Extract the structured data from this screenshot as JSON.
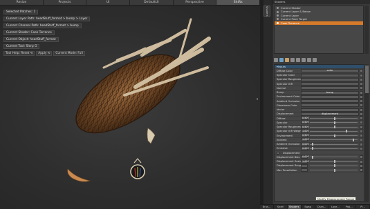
{
  "tabs": [
    "Resize",
    "Projects",
    "UI",
    "DefaultUI",
    "Perspective",
    "Shifts"
  ],
  "active_tab_index": 5,
  "viewport": {
    "info": [
      "Selected Patches: 1",
      "Current Layer Path: headStuff_format > bump > Layer",
      "Current Channel Path: headStuff_format > bump",
      "Current Shader: Cook Torrance",
      "Current Object: headStuff_format",
      "Current Tool: Slerp G"
    ],
    "tool_row": [
      "Tool Help: Reset ⟲",
      "Apply ⟲",
      "Current Mode: Full"
    ]
  },
  "side_tab": "Shaders",
  "panel": {
    "title": "Shaders",
    "layers": [
      "Current Shader",
      "Current Layer & Below",
      "Current Layer",
      "Current Paint Target",
      "Cook Torrance"
    ],
    "selected_layer_index": 4,
    "props": [
      {
        "type": "section",
        "label": "Inputs"
      },
      {
        "type": "field",
        "label": "Diffuse Color",
        "value": "color"
      },
      {
        "type": "field",
        "label": "Specular Color",
        "value": ""
      },
      {
        "type": "field",
        "label": "Specular Roughness",
        "value": ""
      },
      {
        "type": "field",
        "label": "Specular IOR",
        "value": ""
      },
      {
        "type": "field",
        "label": "Normal",
        "value": ""
      },
      {
        "type": "field",
        "label": "Bump",
        "value": "bump"
      },
      {
        "type": "field",
        "label": "Environment Color",
        "value": ""
      },
      {
        "type": "field",
        "label": "Ambient Occlusion",
        "value": ""
      },
      {
        "type": "field",
        "label": "Glossiness Color",
        "value": ""
      },
      {
        "type": "field",
        "label": "Vector",
        "value": ""
      },
      {
        "type": "field",
        "label": "Displacement",
        "value": "displacement"
      },
      {
        "type": "slider",
        "label": "Diffuse",
        "value": "0.500",
        "pos": 0.5
      },
      {
        "type": "slider",
        "label": "Specular",
        "value": "0.500",
        "pos": 0.5
      },
      {
        "type": "slider",
        "label": "Specular Roughness",
        "value": "0.500",
        "pos": 0.5
      },
      {
        "type": "slider",
        "label": "Specular IOR Weight",
        "value": "1.000",
        "pos": 0.75
      },
      {
        "type": "slider",
        "label": "Environment",
        "value": "0.500",
        "pos": 0.5
      },
      {
        "type": "slider",
        "label": "Incident",
        "value": "1.000",
        "pos": 0.9
      },
      {
        "type": "slider",
        "label": "Ambient Occlusion",
        "value": "0.000",
        "pos": 0.05
      },
      {
        "type": "slider",
        "label": "Emissive",
        "value": "0.000",
        "pos": 0.05
      },
      {
        "type": "check",
        "label": "Displacement"
      },
      {
        "type": "slider",
        "label": "Displacement Bias",
        "value": "0.000",
        "pos": 0.05
      },
      {
        "type": "slider",
        "label": "Displacement Scale",
        "value": "1.000",
        "pos": 0.5
      },
      {
        "type": "slider",
        "label": "Displacement Range",
        "value": "",
        "pos": 0.5
      },
      {
        "type": "slider",
        "label": "Max Tessellation",
        "value": "",
        "pos": 0.5
      }
    ]
  },
  "tooltip": "Modify Displacement Range",
  "bottom_tabs": [
    "Brus...",
    "Shelf",
    "Shaders",
    "Swag",
    "Chan...",
    "Laye...",
    "Proj...",
    "Pl..."
  ],
  "active_bottom_tab_index": 2
}
